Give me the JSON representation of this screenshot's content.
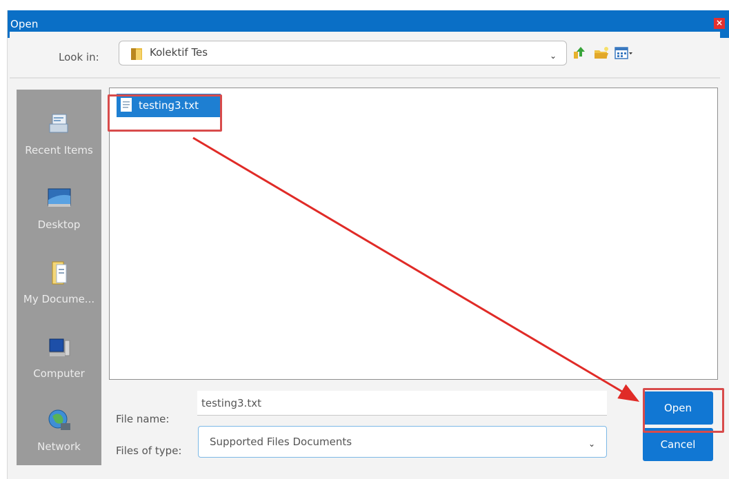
{
  "window": {
    "title": "Open",
    "close_glyph": "×"
  },
  "toolbar": {
    "lookin_label": "Look in:",
    "lookin_value": "Kolektif Tes",
    "icons": [
      "up-one-level-icon",
      "create-new-folder-icon",
      "view-menu-icon"
    ]
  },
  "places": [
    {
      "label": "Recent Items",
      "icon": "recent-items-icon"
    },
    {
      "label": "Desktop",
      "icon": "desktop-icon"
    },
    {
      "label": "My Docume...",
      "icon": "my-documents-icon"
    },
    {
      "label": "Computer",
      "icon": "computer-icon"
    },
    {
      "label": "Network",
      "icon": "network-icon"
    }
  ],
  "files": [
    {
      "name": "testing3.txt",
      "selected": true,
      "icon": "text-file-icon"
    }
  ],
  "form": {
    "filename_label": "File name:",
    "filename_value": "testing3.txt",
    "filetype_label": "Files of type:",
    "filetype_value": "Supported Files Documents"
  },
  "buttons": {
    "open": "Open",
    "cancel": "Cancel"
  },
  "colors": {
    "title_bar": "#0a6fc6",
    "selection": "#1e7fd2",
    "button": "#1177d3",
    "annotation": "#d84b4b",
    "places_bg": "#9b9b9b"
  }
}
